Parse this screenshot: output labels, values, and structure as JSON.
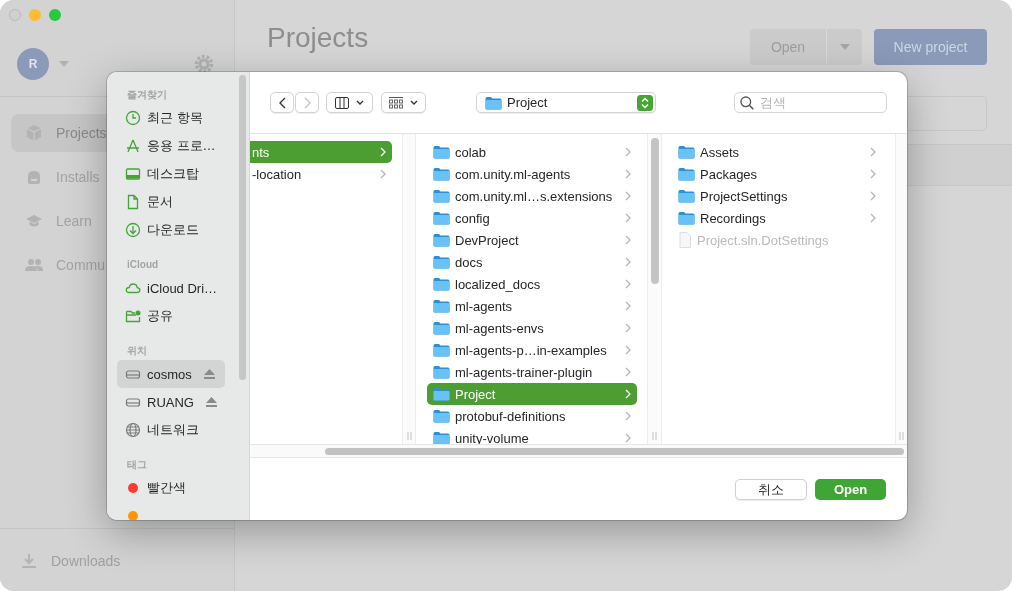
{
  "app": {
    "account": {
      "initial": "R"
    },
    "nav": [
      {
        "label": "Projects",
        "kind": "cube",
        "selected": true
      },
      {
        "label": "Installs",
        "kind": "drive",
        "selected": false
      },
      {
        "label": "Learn",
        "kind": "cap",
        "selected": false
      },
      {
        "label": "Commu",
        "kind": "people",
        "selected": false
      }
    ],
    "downloads": "Downloads",
    "title": "Projects",
    "open_button": "Open",
    "new_project_button": "New project"
  },
  "dialog": {
    "sidebar": [
      {
        "heading": "즐겨찾기",
        "items": [
          {
            "label": "최근 항목",
            "kind": "clock",
            "selected": false
          },
          {
            "label": "응용 프로…",
            "kind": "apps",
            "selected": false
          },
          {
            "label": "데스크탑",
            "kind": "desktop",
            "selected": false
          },
          {
            "label": "문서",
            "kind": "document",
            "selected": false
          },
          {
            "label": "다운로드",
            "kind": "download",
            "selected": false
          }
        ]
      },
      {
        "heading": "iCloud",
        "items": [
          {
            "label": "iCloud Dri…",
            "kind": "cloud",
            "selected": false
          },
          {
            "label": "공유",
            "kind": "shared",
            "selected": false
          }
        ]
      },
      {
        "heading": "위치",
        "items": [
          {
            "label": "cosmos",
            "kind": "drive",
            "selected": true,
            "ejectable": true
          },
          {
            "label": "RUANG",
            "kind": "drive",
            "selected": false,
            "ejectable": true
          },
          {
            "label": "네트워크",
            "kind": "globe",
            "selected": false
          }
        ]
      },
      {
        "heading": "태그",
        "items": [
          {
            "label": "빨간색",
            "kind": "tag",
            "color": "#ff3b30",
            "selected": false
          },
          {
            "kind": "tag",
            "color": "#ff9500",
            "selected": false
          }
        ]
      }
    ],
    "location": "Project",
    "search_placeholder": "검색",
    "columns": [
      {
        "items": [
          {
            "name": "nts",
            "selected": true,
            "has_children": true
          },
          {
            "name": "-location",
            "selected": false,
            "has_children": true
          }
        ]
      },
      {
        "items": [
          {
            "name": "colab",
            "kind": "folder",
            "selected": false,
            "has_children": true
          },
          {
            "name": "com.unity.ml-agents",
            "kind": "folder",
            "selected": false,
            "has_children": true
          },
          {
            "name": "com.unity.ml…s.extensions",
            "kind": "folder",
            "selected": false,
            "has_children": true
          },
          {
            "name": "config",
            "kind": "folder",
            "selected": false,
            "has_children": true
          },
          {
            "name": "DevProject",
            "kind": "folder",
            "selected": false,
            "has_children": true
          },
          {
            "name": "docs",
            "kind": "folder",
            "selected": false,
            "has_children": true
          },
          {
            "name": "localized_docs",
            "kind": "folder",
            "selected": false,
            "has_children": true
          },
          {
            "name": "ml-agents",
            "kind": "folder",
            "selected": false,
            "has_children": true
          },
          {
            "name": "ml-agents-envs",
            "kind": "folder",
            "selected": false,
            "has_children": true
          },
          {
            "name": "ml-agents-p…in-examples",
            "kind": "folder",
            "selected": false,
            "has_children": true
          },
          {
            "name": "ml-agents-trainer-plugin",
            "kind": "folder",
            "selected": false,
            "has_children": true
          },
          {
            "name": "Project",
            "kind": "folder",
            "selected": true,
            "has_children": true
          },
          {
            "name": "protobuf-definitions",
            "kind": "folder",
            "selected": false,
            "has_children": true
          },
          {
            "name": "unity-volume",
            "kind": "folder",
            "selected": false,
            "has_children": true
          }
        ]
      },
      {
        "items": [
          {
            "name": "Assets",
            "kind": "folder",
            "selected": false,
            "has_children": true,
            "disabled": false
          },
          {
            "name": "Packages",
            "kind": "folder",
            "selected": false,
            "has_children": true,
            "disabled": false
          },
          {
            "name": "ProjectSettings",
            "kind": "folder",
            "selected": false,
            "has_children": true,
            "disabled": false
          },
          {
            "name": "Recordings",
            "kind": "folder",
            "selected": false,
            "has_children": true,
            "disabled": false
          },
          {
            "name": "Project.sln.DotSettings",
            "kind": "file",
            "selected": false,
            "has_children": false,
            "disabled": true
          }
        ]
      }
    ],
    "cancel_button": "취소",
    "open_button": "Open"
  }
}
